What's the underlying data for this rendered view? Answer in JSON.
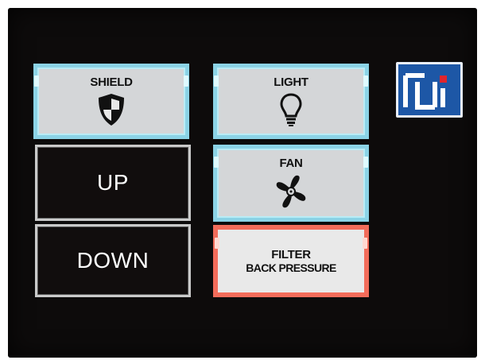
{
  "buttons": {
    "shield": {
      "label": "SHIELD",
      "icon": "shield-icon"
    },
    "light": {
      "label": "LIGHT",
      "icon": "lightbulb-icon"
    },
    "up": {
      "label": "UP"
    },
    "fan": {
      "label": "FAN",
      "icon": "fan-icon"
    },
    "down": {
      "label": "DOWN"
    },
    "filter": {
      "line1": "FILTER",
      "line2": "BACK PRESSURE"
    }
  },
  "logo": {
    "text": "TI",
    "icon": "ti-logo"
  },
  "colors": {
    "active_border": "#8bd3e6",
    "alarm_border": "#f26c5a",
    "logo_blue": "#1d57a6",
    "logo_red": "#e0252d",
    "screen_bg": "#0d0b0b"
  }
}
